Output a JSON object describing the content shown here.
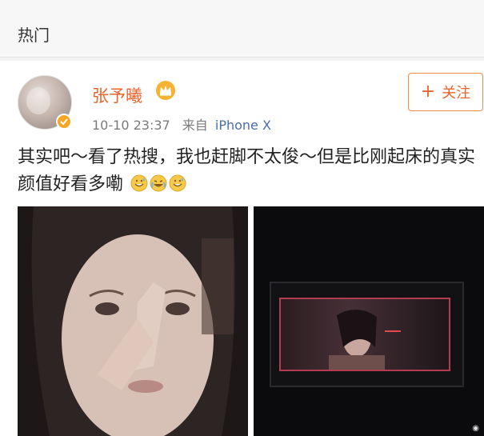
{
  "section": {
    "title": "热门"
  },
  "post": {
    "username": "张予曦",
    "time": "10-10 23:37",
    "source_prefix": "来自",
    "source": "iPhone X",
    "follow_label": "关注",
    "text": "其实吧～看了热搜，我也赶脚不太俊～但是比刚起床的真实颜值好看多嘞"
  },
  "icons": {
    "crown": "crown-icon",
    "verify": "verified-badge-icon",
    "emoji": [
      "grin-sweat-emoji-icon",
      "laugh-cry-emoji-icon",
      "grin-sweat-emoji-icon"
    ],
    "plus": "plus-icon"
  },
  "colors": {
    "accent": "#e8632a",
    "link": "#4a6fa5",
    "badge": "#f6a623",
    "monitor_border": "#b33c50"
  }
}
